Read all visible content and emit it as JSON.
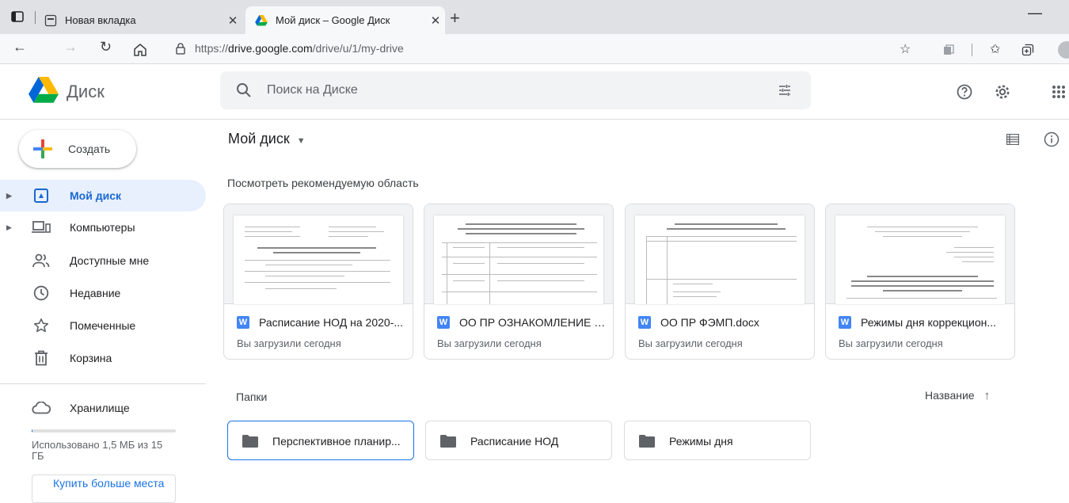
{
  "browser": {
    "tabs": [
      {
        "title": "Новая вкладка"
      },
      {
        "title": "Мой диск – Google Диск"
      }
    ],
    "url_prefix": "https://",
    "url_host": "drive.google.com",
    "url_path": "/drive/u/1/my-drive"
  },
  "header": {
    "app_name": "Диск",
    "search_placeholder": "Поиск на Диске"
  },
  "sidebar": {
    "create_label": "Создать",
    "items": [
      {
        "label": "Мой диск"
      },
      {
        "label": "Компьютеры"
      },
      {
        "label": "Доступные мне"
      },
      {
        "label": "Недавние"
      },
      {
        "label": "Помеченные"
      },
      {
        "label": "Корзина"
      },
      {
        "label": "Хранилище"
      }
    ],
    "storage_text": "Использовано 1,5 МБ из 15 ГБ",
    "storage_fraction": 0.0001,
    "buy_label": "Купить больше места"
  },
  "main": {
    "title": "Мой диск",
    "suggested_title": "Посмотреть рекомендуемую область",
    "files": [
      {
        "name": "Расписание НОД на 2020-...",
        "sub": "Вы загрузили сегодня",
        "icon": "W"
      },
      {
        "name": "ОО ПР ОЗНАКОМЛЕНИЕ С...",
        "sub": "Вы загрузили сегодня",
        "icon": "W"
      },
      {
        "name": "ОО ПР ФЭМП.docx",
        "sub": "Вы загрузили сегодня",
        "icon": "W"
      },
      {
        "name": "Режимы дня коррекцион...",
        "sub": "Вы загрузили сегодня",
        "icon": "W"
      }
    ],
    "folders_title": "Папки",
    "sort_label": "Название",
    "folders": [
      {
        "name": "Перспективное планир..."
      },
      {
        "name": "Расписание НОД"
      },
      {
        "name": "Режимы дня"
      }
    ]
  },
  "colors": {
    "accent": "#1a73e8",
    "selected_bg": "#e8f0fe",
    "word_blue": "#4285f4"
  }
}
